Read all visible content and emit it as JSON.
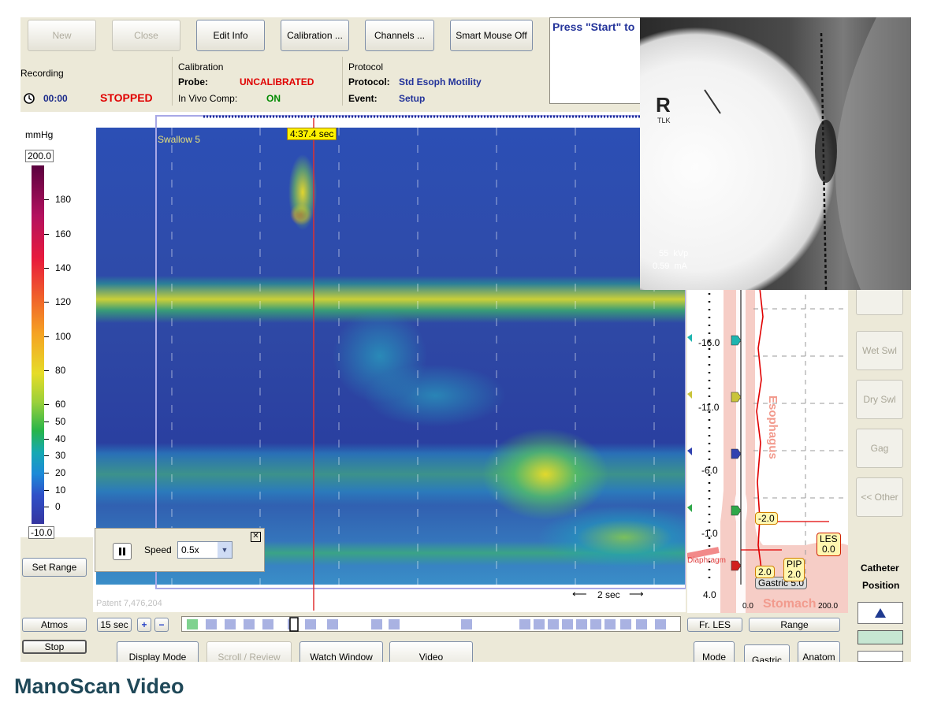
{
  "toolbar": {
    "new": "New",
    "close": "Close",
    "edit_info": "Edit Info",
    "calibration": "Calibration ...",
    "channels": "Channels ...",
    "smart_mouse": "Smart Mouse Off"
  },
  "message": "Press \"Start\" to",
  "status": {
    "recording_label": "Recording",
    "time": "00:00",
    "state": "STOPPED",
    "calibration_header": "Calibration",
    "probe_label": "Probe:",
    "probe_value": "UNCALIBRATED",
    "invivo_label": "In Vivo Comp:",
    "invivo_value": "ON",
    "protocol_header": "Protocol",
    "protocol_label": "Protocol:",
    "protocol_value": "Std Esoph Motility",
    "event_label": "Event:",
    "event_value": "Setup"
  },
  "scale": {
    "unit": "mmHg",
    "max": "200.0",
    "min": "-10.0",
    "ticks": [
      "180",
      "160",
      "140",
      "120",
      "100",
      "80",
      "60",
      "50",
      "40",
      "30",
      "20",
      "10",
      "0"
    ]
  },
  "plot": {
    "cursor_time": "4:37.4 sec",
    "swallow_label": "Swallow 5",
    "patent": "Patent 7,476,204",
    "time_span": "2 sec"
  },
  "playback": {
    "speed_label": "Speed",
    "speed_value": "0.5x",
    "window": "15 sec"
  },
  "left_buttons": {
    "set_range": "Set Range",
    "atmos": "Atmos",
    "stop": "Stop"
  },
  "bottom_tabs": [
    "Display Mode",
    "Scroll / Review",
    "Watch Window",
    "Video"
  ],
  "anatomy": {
    "esophagus": "Esophagus",
    "stomach": "Stomach",
    "diaphragm": "Diaphragm",
    "gastric": "Gastric 5.0",
    "positions": [
      "-16.0",
      "-11.0",
      "-6.0",
      "-1.0",
      "4.0"
    ],
    "x_min": "0.0",
    "x_max": "200.0",
    "tag_minus2": "-2.0",
    "tag_2": "2.0",
    "pip_label": "PIP",
    "pip_value": "2.0",
    "les_label": "LES",
    "les_value": "0.0",
    "fr_les": "Fr. LES",
    "range": "Range",
    "mode_tabs": [
      "Mode",
      "Gastric",
      "Anatom"
    ]
  },
  "right_panel": {
    "wet_swl": "Wet Swl",
    "dry_swl": "Dry Swl",
    "gag": "Gag",
    "other": "<< Other",
    "catheter": "Catheter",
    "position": "Position"
  },
  "xray": {
    "marker": "R",
    "marker_sub": "TLK",
    "kvp": "55  kVp",
    "ma": "0.59  mA"
  },
  "caption": "ManoScan Video"
}
